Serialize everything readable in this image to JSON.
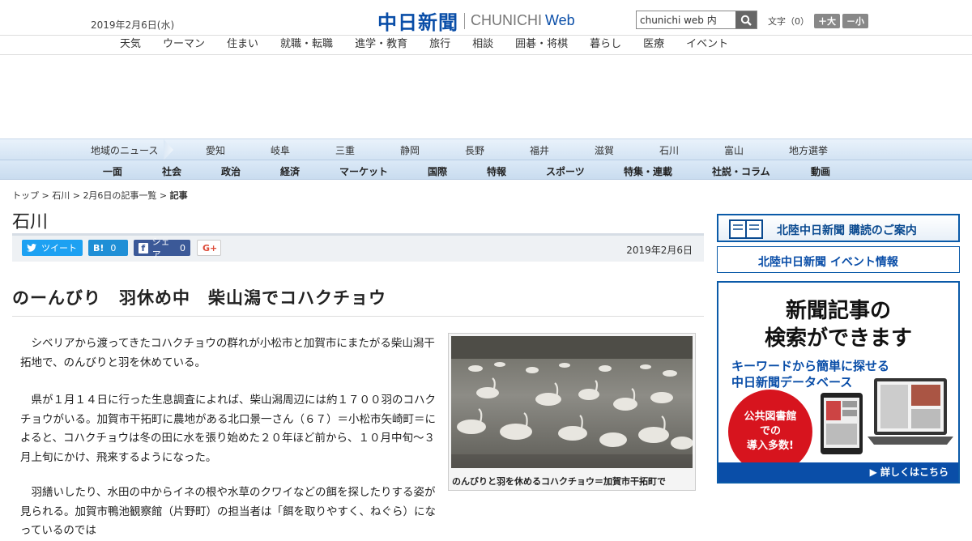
{
  "header": {
    "date": "2019年2月6日(水)",
    "logo_jp": "中日新聞",
    "logo_en": "CHUNICHI",
    "logo_web": "Web",
    "search_value": "chunichi web 内",
    "font_label": "文字（0）",
    "font_bigger": "＋大",
    "font_smaller": "－小"
  },
  "subnav": [
    "天気",
    "ウーマン",
    "住まい",
    "就職・転職",
    "進学・教育",
    "旅行",
    "相談",
    "囲碁・将棋",
    "暮らし",
    "医療",
    "イベント"
  ],
  "region_nav": {
    "label": "地域のニュース",
    "items": [
      "愛知",
      "岐阜",
      "三重",
      "静岡",
      "長野",
      "福井",
      "滋賀",
      "石川",
      "富山",
      "地方選挙"
    ]
  },
  "main_nav": [
    "一面",
    "社会",
    "政治",
    "経済",
    "マーケット",
    "国際",
    "特報",
    "スポーツ",
    "特集・連載",
    "社説・コラム",
    "動画"
  ],
  "breadcrumb": {
    "top": "トップ",
    "sep": " > ",
    "pref": "石川",
    "list": "2月6日の記事一覧",
    "current": "記事"
  },
  "section_title": "石川",
  "share": {
    "tweet": "ツイート",
    "hatena": "B!",
    "hatena_count": "0",
    "fb": "シェア",
    "fb_count": "0",
    "gplus": "G+",
    "date": "2019年2月6日"
  },
  "article": {
    "headline": "のーんびり　羽休め中　柴山潟でコハクチョウ",
    "paragraphs": [
      "シベリアから渡ってきたコハクチョウの群れが小松市と加賀市にまたがる柴山潟干拓地で、のんびりと羽を休めている。",
      "県が１月１４日に行った生息調査によれば、柴山潟周辺には約１７００羽のコハクチョウがいる。加賀市干拓町に農地がある北口景一さん（６７）＝小松市矢崎町＝によると、コハクチョウは冬の田に水を張り始めた２０年ほど前から、１０月中旬～３月上旬にかけ、飛来するようになった。",
      "羽繕いしたり、水田の中からイネの根や水草のクワイなどの餌を探したりする姿が見られる。加賀市鴨池観察館（片野町）の担当者は「餌を取りやすく、ねぐら）になっているのでは"
    ],
    "photo_caption": "のんびりと羽を休めるコハクチョウ＝加賀市干拓町で"
  },
  "sidebar": {
    "banner1": "北陸中日新聞 購読のご案内",
    "banner2": "北陸中日新聞 イベント情報",
    "banner3_line1": "新聞記事の",
    "banner3_line2": "検索ができます",
    "banner3_line3": "キーワードから簡単に探せる",
    "banner3_line4": "中日新聞データベース",
    "circle_l1": "公共図書館",
    "circle_l2": "での",
    "circle_l3": "導入多数!",
    "footer": "▶ 詳しくはこちら"
  }
}
